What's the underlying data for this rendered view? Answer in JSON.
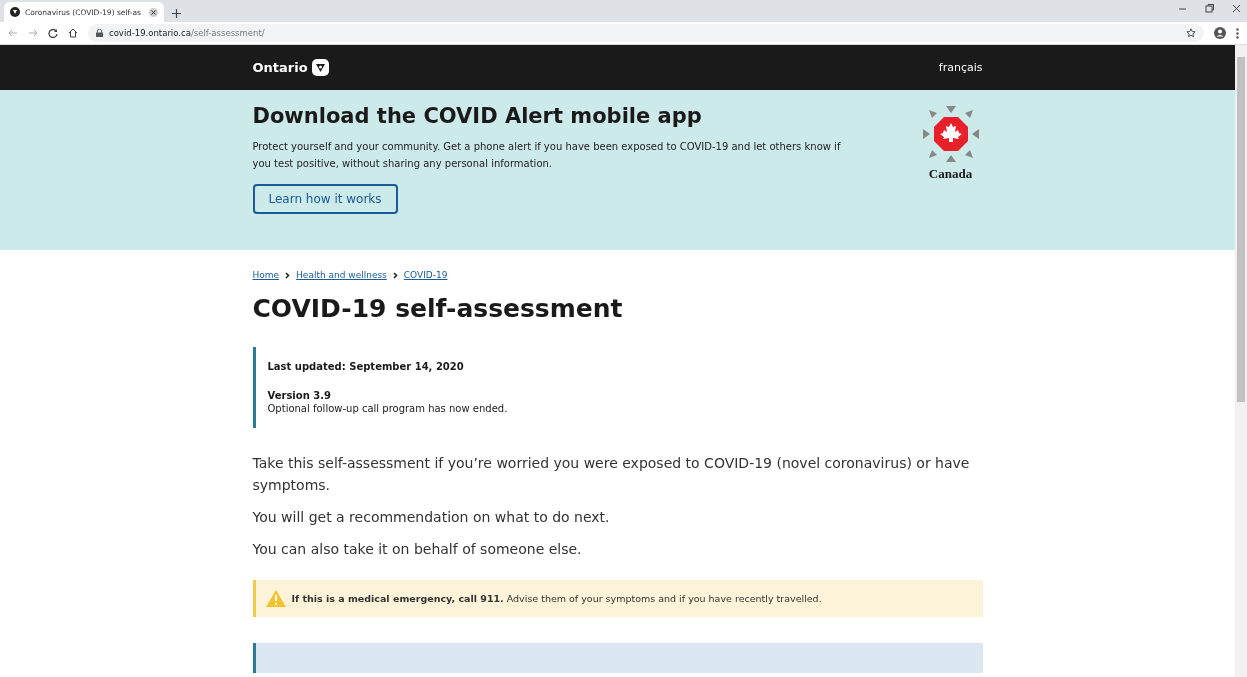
{
  "browser": {
    "tab_title": "Coronavirus (COVID-19) self-as",
    "url_host": "covid-19.ontario.ca",
    "url_path": "/self-assessment/"
  },
  "header": {
    "logo": "Ontario",
    "language_link": "français"
  },
  "banner": {
    "title": "Download the COVID Alert mobile app",
    "text": "Protect yourself and your community. Get a phone alert if you have been exposed to COVID-19 and let others know if you test positive, without sharing any personal information.",
    "button": "Learn how it works",
    "logo_text": "Canada"
  },
  "breadcrumbs": [
    "Home",
    "Health and wellness",
    "COVID-19"
  ],
  "page_title": "COVID-19 self-assessment",
  "notice": {
    "updated": "Last updated: September 14, 2020",
    "version": "Version 3.9",
    "note": "Optional follow-up call program has now ended."
  },
  "paragraphs": [
    "Take this self-assessment if you’re worried you were exposed to COVID-19 (novel coronavirus) or have symptoms.",
    "You will get a recommendation on what to do next.",
    "You can also take it on behalf of someone else."
  ],
  "warning": "**If this is a medical emergency, call 911.** Advise them of your symptoms and if you have recently travelled."
}
